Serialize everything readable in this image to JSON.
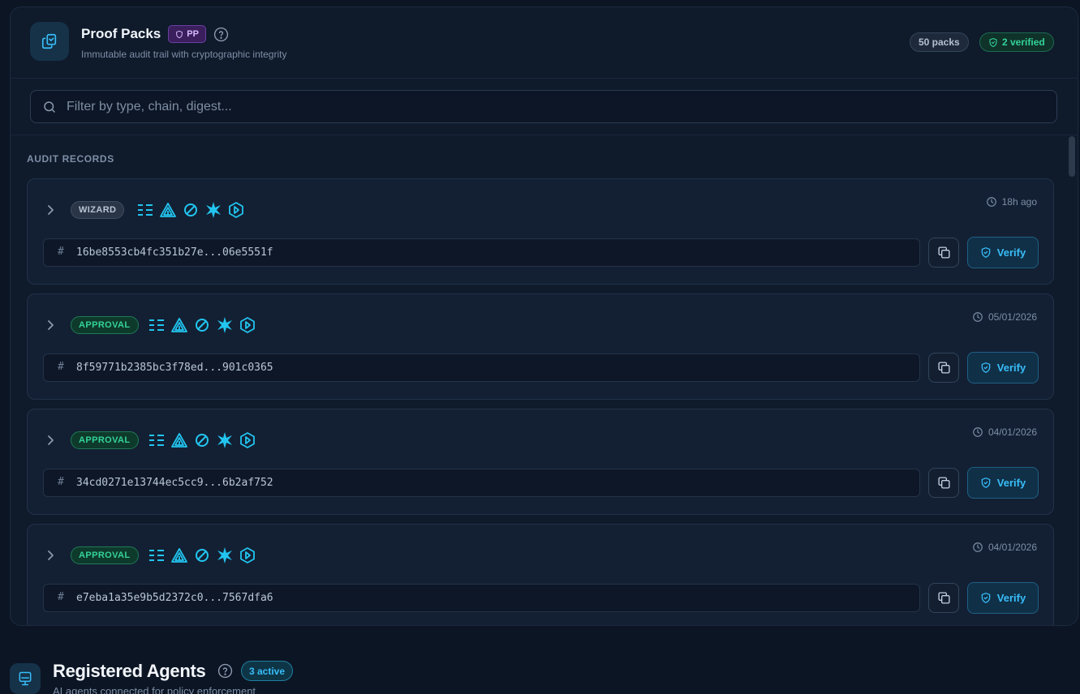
{
  "header": {
    "title": "Proof Packs",
    "badge": "PP",
    "subtitle": "Immutable audit trail with cryptographic integrity",
    "packs_count": "50 packs",
    "verified_count": "2 verified"
  },
  "search": {
    "placeholder": "Filter by type, chain, digest..."
  },
  "section_label": "AUDIT RECORDS",
  "records": [
    {
      "type": "WIZARD",
      "time": "18h ago",
      "digest": "16be8553cb4fc351b27e...06e5551f",
      "verify_label": "Verify"
    },
    {
      "type": "APPROVAL",
      "time": "05/01/2026",
      "digest": "8f59771b2385bc3f78ed...901c0365",
      "verify_label": "Verify"
    },
    {
      "type": "APPROVAL",
      "time": "04/01/2026",
      "digest": "34cd0271e13744ec5cc9...6b2af752",
      "verify_label": "Verify"
    },
    {
      "type": "APPROVAL",
      "time": "04/01/2026",
      "digest": "e7eba1a35e9b5d2372c0...7567dfa6",
      "verify_label": "Verify"
    }
  ],
  "chain_icon_names": [
    "list-icon",
    "pyramid-icon",
    "slash-circle-icon",
    "star-icon",
    "hexagon-icon"
  ],
  "agents": {
    "title": "Registered Agents",
    "active_count": "3 active",
    "subtitle": "AI agents connected for policy enforcement"
  },
  "colors": {
    "background": "#0c1524",
    "panel": "#0f1a2b",
    "accent_cyan": "#38bdf8",
    "chain_icon": "#22c5f0",
    "approval_green": "#34d399",
    "pp_purple": "#d7b9ff"
  }
}
